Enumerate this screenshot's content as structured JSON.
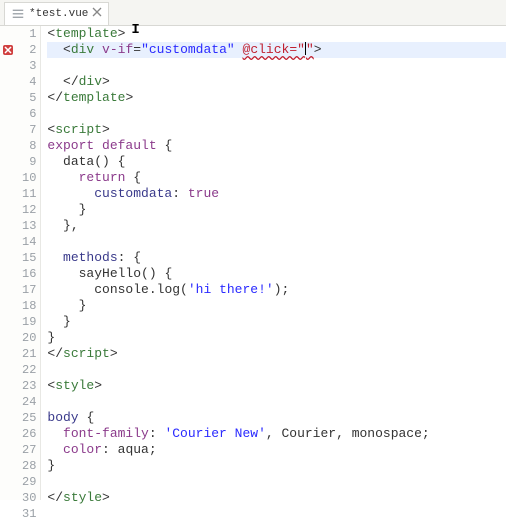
{
  "tab": {
    "filename": "*test.vue"
  },
  "lines": [
    1,
    2,
    3,
    4,
    5,
    6,
    7,
    8,
    9,
    10,
    11,
    12,
    13,
    14,
    15,
    16,
    17,
    18,
    19,
    20,
    21,
    22,
    23,
    24,
    25,
    26,
    27,
    28,
    29,
    30,
    31
  ],
  "code": {
    "l1": {
      "open": "<",
      "tag": "template",
      "close": ">"
    },
    "l2": {
      "indent": "  ",
      "open": "<",
      "tag": "div",
      "sp": " ",
      "attr1": "v-if",
      "eq1": "=",
      "val1": "\"customdata\"",
      "sp2": " ",
      "err": "@click=\"",
      "afterErr": "\"",
      "close": ">"
    },
    "l4": {
      "indent": "  ",
      "open": "</",
      "tag": "div",
      "close": ">"
    },
    "l5": {
      "open": "</",
      "tag": "template",
      "close": ">"
    },
    "l7": {
      "open": "<",
      "tag": "script",
      "close": ">"
    },
    "l8": {
      "kw": "export default",
      "sp": " ",
      "brace": "{"
    },
    "l9": {
      "indent": "  ",
      "name": "data",
      "paren": "()",
      "sp": " ",
      "brace": "{"
    },
    "l10": {
      "indent": "    ",
      "kw": "return",
      "sp": " ",
      "brace": "{"
    },
    "l11": {
      "indent": "      ",
      "key": "customdata",
      "colon": ": ",
      "val": "true"
    },
    "l12": {
      "indent": "    ",
      "brace": "}"
    },
    "l13": {
      "indent": "  ",
      "brace": "},"
    },
    "l15": {
      "indent": "  ",
      "key": "methods",
      "colon": ": ",
      "brace": "{"
    },
    "l16": {
      "indent": "    ",
      "name": "sayHello",
      "paren": "()",
      "sp": " ",
      "brace": "{"
    },
    "l17": {
      "indent": "      ",
      "obj": "console",
      "dot": ".",
      "fn": "log",
      "open": "(",
      "str": "'hi there!'",
      "close": ");"
    },
    "l18": {
      "indent": "    ",
      "brace": "}"
    },
    "l19": {
      "indent": "  ",
      "brace": "}"
    },
    "l20": {
      "brace": "}"
    },
    "l21": {
      "open": "</",
      "tag": "script",
      "close": ">"
    },
    "l23": {
      "open": "<",
      "tag": "style",
      "close": ">"
    },
    "l25": {
      "sel": "body",
      "sp": " ",
      "brace": "{"
    },
    "l26": {
      "indent": "  ",
      "prop": "font-family",
      "colon": ": ",
      "valq": "'Courier New'",
      "rest": ", Courier, monospace;"
    },
    "l27": {
      "indent": "  ",
      "prop": "color",
      "colon": ": ",
      "val": "aqua",
      "semi": ";"
    },
    "l28": {
      "brace": "}"
    },
    "l30": {
      "open": "</",
      "tag": "style",
      "close": ">"
    }
  },
  "chart_data": null
}
